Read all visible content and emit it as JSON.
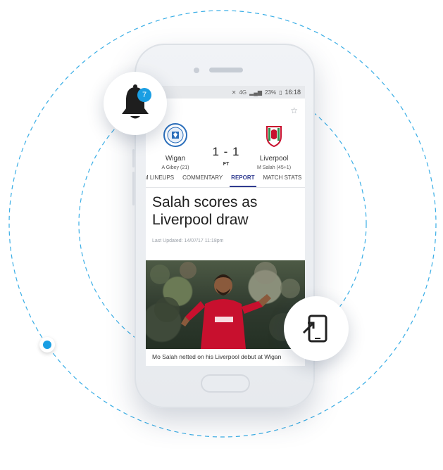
{
  "status_bar": {
    "battery": "23%",
    "time": "16:18"
  },
  "match": {
    "home": {
      "name": "Wigan",
      "scorer": "A Gibey (21)"
    },
    "away": {
      "name": "Liverpool",
      "scorer": "M Salah (45+1)"
    },
    "score": "1 - 1",
    "status": "FT"
  },
  "tabs": [
    {
      "label": "M LINEUPS"
    },
    {
      "label": "COMMENTARY"
    },
    {
      "label": "REPORT",
      "active": true
    },
    {
      "label": "MATCH STATS"
    }
  ],
  "article": {
    "headline": "Salah scores as Liverpool draw",
    "updated": "Last Updated: 14/07/17 11:18pm",
    "caption": "Mo Salah netted on his Liverpool debut at Wigan"
  },
  "notification": {
    "count": "7",
    "icon": "bell-icon"
  },
  "share": {
    "icon": "phone-share-icon"
  },
  "colors": {
    "accent": "#1a9ee3",
    "tab_active": "#2f3a8f",
    "liverpool_red": "#c8102e"
  }
}
